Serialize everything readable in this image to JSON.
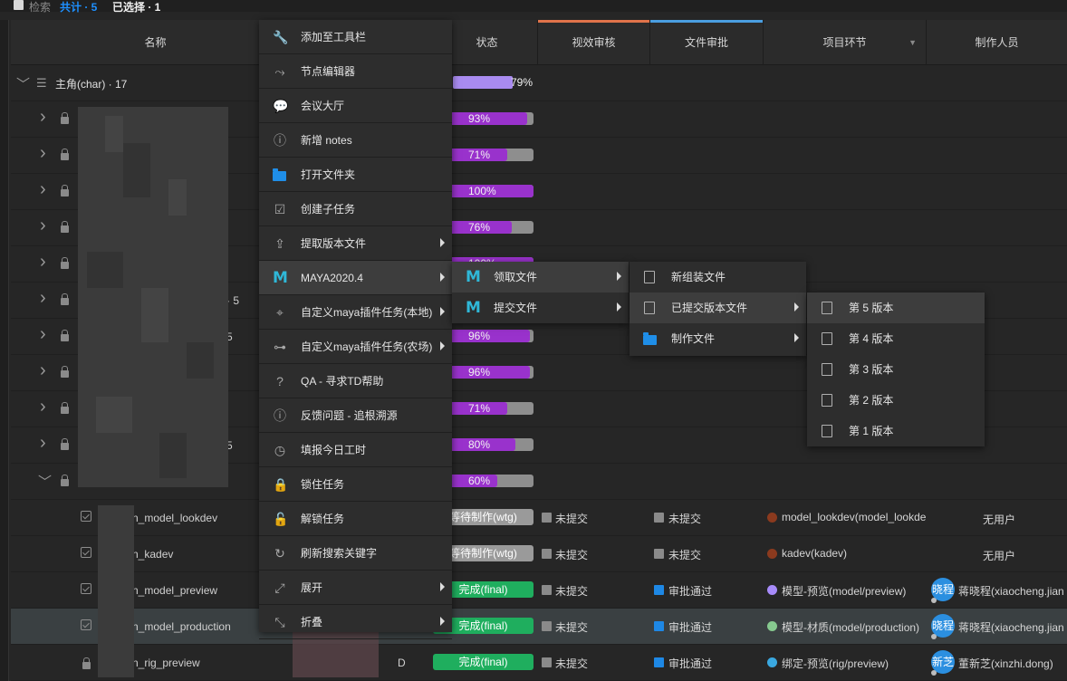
{
  "topbar": {
    "search_label": "检索",
    "total_label": "共计 · 5",
    "selected_label": "已选择 · 1"
  },
  "header": {
    "columns": [
      "名称",
      "状态",
      "视效审核",
      "文件审批",
      "项目环节",
      "制作人员"
    ],
    "accent_colors": {
      "visual_review": "#e0734a",
      "file_approval": "#4a9ee0"
    }
  },
  "group": {
    "label": "主角(char) · 17",
    "progress_text": "79%",
    "progress": 0.79
  },
  "task_rows": [
    {
      "progress": 0.93,
      "progress_text": "93%",
      "suffix": ""
    },
    {
      "progress": 0.71,
      "progress_text": "71%",
      "suffix": ""
    },
    {
      "progress": 1.0,
      "progress_text": "100%",
      "suffix": ""
    },
    {
      "progress": 0.76,
      "progress_text": "76%",
      "suffix": ""
    },
    {
      "progress": 1.0,
      "progress_text": "100%",
      "suffix": ""
    },
    {
      "progress": null,
      "progress_text": "",
      "suffix": "· 5"
    },
    {
      "progress": 0.96,
      "progress_text": "96%",
      "suffix": "5"
    },
    {
      "progress": 0.96,
      "progress_text": "96%",
      "suffix": ""
    },
    {
      "progress": 0.71,
      "progress_text": "71%",
      "suffix": ""
    },
    {
      "progress": 0.8,
      "progress_text": "80%",
      "suffix": "5"
    },
    {
      "progress": 0.6,
      "progress_text": "60%",
      "suffix": ""
    }
  ],
  "detail_rows": [
    {
      "name": "n_model_lookdev",
      "status": "等待制作(wtg)",
      "status_color": "#9a9a9a",
      "visual": "未提交",
      "visual_color": "#8a8a8a",
      "file": "未提交",
      "file_color": "#8a8a8a",
      "step": "model_lookdev(model_lookde",
      "step_color": "#8b3a1e",
      "user": "无用户",
      "avatar": "",
      "lead": "",
      "selected": false
    },
    {
      "name": "n_kadev",
      "status": "等待制作(wtg)",
      "status_color": "#9a9a9a",
      "visual": "未提交",
      "visual_color": "#8a8a8a",
      "file": "未提交",
      "file_color": "#8a8a8a",
      "step": "kadev(kadev)",
      "step_color": "#8b3a1e",
      "user": "无用户",
      "avatar": "",
      "lead": "",
      "selected": false
    },
    {
      "name": "n_model_preview",
      "status": "完成(final)",
      "status_color": "#1fae5e",
      "visual": "未提交",
      "visual_color": "#8a8a8a",
      "file": "审批通过",
      "file_color": "#1e88e5",
      "step": "模型-预览(model/preview)",
      "step_color": "#a78bfa",
      "user": "蒋晓程(xiaocheng.jian",
      "avatar": "晓程",
      "lead": "",
      "selected": false
    },
    {
      "name": "n_model_production",
      "status": "完成(final)",
      "status_color": "#1fae5e",
      "visual": "未提交",
      "visual_color": "#8a8a8a",
      "file": "审批通过",
      "file_color": "#1e88e5",
      "step": "模型-材质(model/production)",
      "step_color": "#86c98f",
      "user": "蒋晓程(xiaocheng.jian",
      "avatar": "晓程",
      "lead": "",
      "selected": true
    },
    {
      "name": "n_rig_preview",
      "status": "完成(final)",
      "status_color": "#1fae5e",
      "visual": "未提交",
      "visual_color": "#8a8a8a",
      "file": "审批通过",
      "file_color": "#1e88e5",
      "step": "绑定-预览(rig/preview)",
      "step_color": "#3aa8e0",
      "user": "董新芝(xinzhi.dong)",
      "avatar": "新芝",
      "lead": "D",
      "selected": false
    }
  ],
  "context_menu": [
    {
      "label": "添加至工具栏",
      "icon": "wrench-icon",
      "glyph": "🔧",
      "has_sub": false
    },
    {
      "label": "节点编辑器",
      "icon": "node-editor-icon",
      "glyph": "⤳",
      "has_sub": false
    },
    {
      "label": "会议大厅",
      "icon": "chat-icon",
      "glyph": "💬",
      "has_sub": false
    },
    {
      "label": "新增 notes",
      "icon": "alert-circle-icon",
      "glyph": "ⓘ",
      "has_sub": false
    },
    {
      "label": "打开文件夹",
      "icon": "folder-icon",
      "glyph": "",
      "has_sub": false
    },
    {
      "label": "创建子任务",
      "icon": "checkbox-icon",
      "glyph": "☑",
      "has_sub": false
    },
    {
      "label": "提取版本文件",
      "icon": "share-icon",
      "glyph": "⇪",
      "has_sub": true
    },
    {
      "label": "MAYA2020.4",
      "icon": "maya-icon",
      "glyph": "M",
      "has_sub": true,
      "highlight": true
    },
    {
      "label": "自定义maya插件任务(本地)",
      "icon": "location-pin-icon",
      "glyph": "⌖",
      "has_sub": true
    },
    {
      "label": "自定义maya插件任务(农场)",
      "icon": "hierarchy-icon",
      "glyph": "⊶",
      "has_sub": true
    },
    {
      "label": "QA - 寻求TD帮助",
      "icon": "question-icon",
      "glyph": "?",
      "has_sub": false
    },
    {
      "label": "反馈问题 - 追根溯源",
      "icon": "info-icon",
      "glyph": "ⓘ",
      "has_sub": false
    },
    {
      "label": "填报今日工时",
      "icon": "clock-icon",
      "glyph": "◷",
      "has_sub": false
    },
    {
      "label": "锁住任务",
      "icon": "lock-icon",
      "glyph": "🔒",
      "has_sub": false
    },
    {
      "label": "解锁任务",
      "icon": "unlock-icon",
      "glyph": "🔓",
      "has_sub": false
    },
    {
      "label": "刷新搜索关键字",
      "icon": "refresh-icon",
      "glyph": "↻",
      "has_sub": false
    },
    {
      "label": "展开",
      "icon": "expand-icon",
      "glyph": "⤢",
      "has_sub": true
    },
    {
      "label": "折叠",
      "icon": "collapse-icon",
      "glyph": "⤡",
      "has_sub": true
    }
  ],
  "maya_submenu": [
    {
      "label": "领取文件",
      "icon": "maya-icon",
      "highlight": true
    },
    {
      "label": "提交文件",
      "icon": "maya-icon",
      "highlight": false
    }
  ],
  "fetch_submenu": [
    {
      "label": "新组装文件",
      "icon": "file-icon",
      "highlight": false
    },
    {
      "label": "已提交版本文件",
      "icon": "file-clock-icon",
      "highlight": true
    },
    {
      "label": "制作文件",
      "icon": "folder-icon",
      "highlight": false
    }
  ],
  "version_submenu": [
    {
      "label": "第 5 版本",
      "icon": "file-clock-icon",
      "highlight": true
    },
    {
      "label": "第 4 版本",
      "icon": "file-clock-icon",
      "highlight": false
    },
    {
      "label": "第 3 版本",
      "icon": "file-clock-icon",
      "highlight": false
    },
    {
      "label": "第 2 版本",
      "icon": "file-clock-icon",
      "highlight": false
    },
    {
      "label": "第 1 版本",
      "icon": "file-clock-icon",
      "highlight": false
    }
  ]
}
